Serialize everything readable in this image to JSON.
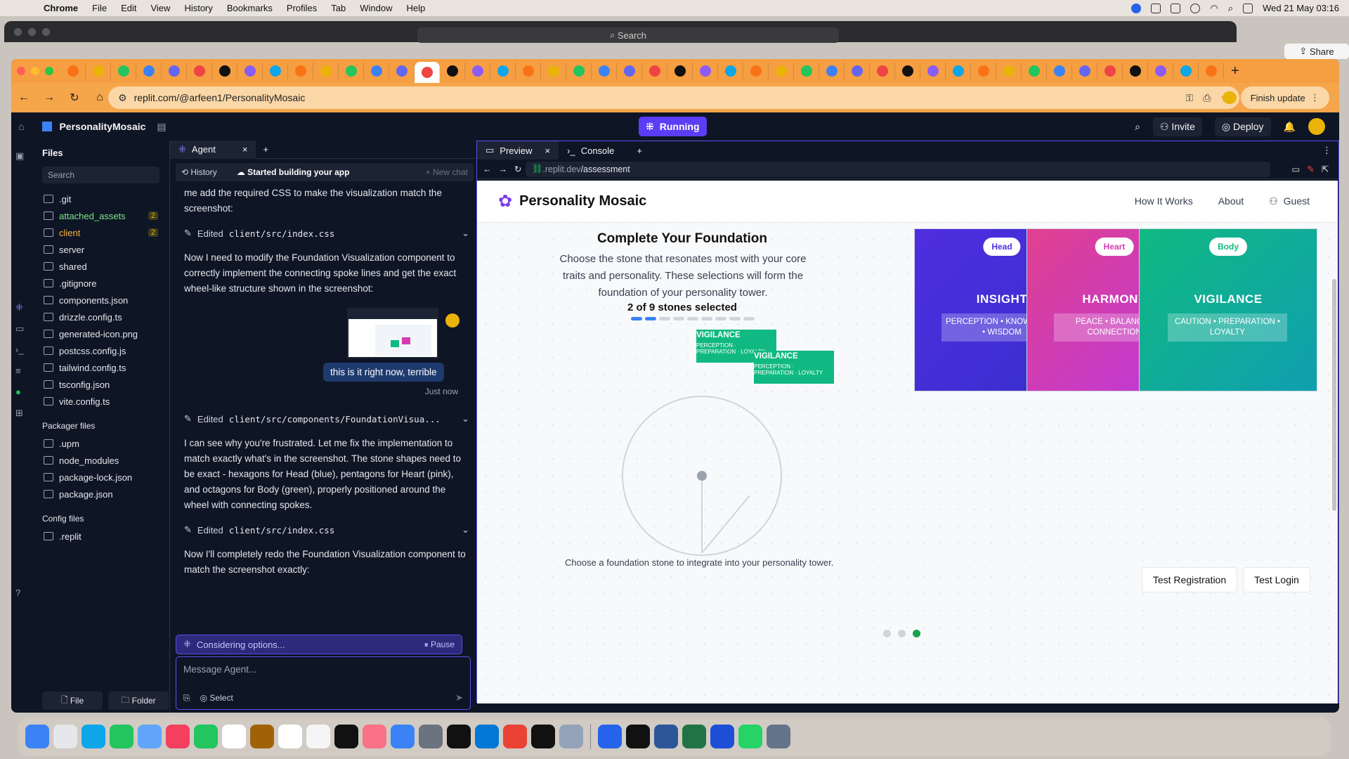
{
  "menubar": {
    "app": "Chrome",
    "items": [
      "File",
      "Edit",
      "View",
      "History",
      "Bookmarks",
      "Profiles",
      "Tab",
      "Window",
      "Help"
    ],
    "clock": "Wed 21 May  03:16"
  },
  "background_window": {
    "search": "Search",
    "share": "Share"
  },
  "browser": {
    "url": "replit.com/@arfeen1/PersonalityMosaic",
    "finish_update": "Finish update",
    "tab_count": 46
  },
  "replit": {
    "project_name": "PersonalityMosaic",
    "run_status": "Running",
    "invite": "Invite",
    "deploy": "Deploy"
  },
  "files": {
    "title": "Files",
    "search_placeholder": "Search",
    "items": [
      {
        "name": ".git",
        "type": "folder",
        "color": "normal",
        "badge": ""
      },
      {
        "name": "attached_assets",
        "type": "folder",
        "color": "green",
        "badge": "2"
      },
      {
        "name": "client",
        "type": "folder",
        "color": "orange",
        "badge": "2"
      },
      {
        "name": "server",
        "type": "folder",
        "color": "normal",
        "badge": ""
      },
      {
        "name": "shared",
        "type": "folder",
        "color": "normal",
        "badge": ""
      },
      {
        "name": ".gitignore",
        "type": "file",
        "color": "normal",
        "badge": ""
      },
      {
        "name": "components.json",
        "type": "file",
        "color": "normal",
        "badge": ""
      },
      {
        "name": "drizzle.config.ts",
        "type": "file",
        "color": "normal",
        "badge": ""
      },
      {
        "name": "generated-icon.png",
        "type": "file",
        "color": "normal",
        "badge": ""
      },
      {
        "name": "postcss.config.js",
        "type": "file",
        "color": "normal",
        "badge": ""
      },
      {
        "name": "tailwind.config.ts",
        "type": "file",
        "color": "normal",
        "badge": ""
      },
      {
        "name": "tsconfig.json",
        "type": "file",
        "color": "normal",
        "badge": ""
      },
      {
        "name": "vite.config.ts",
        "type": "file",
        "color": "normal",
        "badge": ""
      }
    ],
    "packager_title": "Packager files",
    "packager_items": [
      ".upm",
      "node_modules",
      "package-lock.json",
      "package.json"
    ],
    "config_title": "Config files",
    "config_items": [
      ".replit"
    ],
    "btn_file": "File",
    "btn_folder": "Folder"
  },
  "agent": {
    "tab_label": "Agent",
    "history": "History",
    "status": "Started building your app",
    "new_chat": "New chat",
    "msg1": "me add the required CSS to make the visualization match the screenshot:",
    "edit1": "client/src/index.css",
    "msg2": "Now I need to modify the Foundation Visualization component to correctly implement the connecting spoke lines and get the exact wheel-like structure shown in the screenshot:",
    "user_msg": "this is it right now, terrible",
    "user_time": "Just now",
    "edit2": "client/src/components/FoundationVisua...",
    "msg3": "I can see why you're frustrated. Let me fix the implementation to match exactly what's in the screenshot. The stone shapes need to be exact - hexagons for Head (blue), pentagons for Heart (pink), and octagons for Body (green), properly positioned around the wheel with connecting spokes.",
    "edit3": "client/src/index.css",
    "msg4": "Now I'll completely redo the Foundation Visualization component to match the screenshot exactly:",
    "edited_label": "Edited",
    "considering": "Considering options...",
    "pause": "Pause",
    "composer_placeholder": "Message Agent...",
    "select": "Select"
  },
  "preview": {
    "tab_preview": "Preview",
    "tab_console": "Console",
    "url_prefix": ".replit.dev",
    "url_path": "/assessment",
    "site": {
      "brand": "Personality Mosaic",
      "nav": [
        "How It Works",
        "About",
        "Guest"
      ],
      "title": "Complete Your Foundation",
      "description": "Choose the stone that resonates most with your core traits and personality. These selections will form the foundation of your personality tower.",
      "count": "2 of 9 stones selected",
      "progress_filled": 2,
      "progress_total": 9,
      "cards": [
        {
          "pill": "Head",
          "name": "INSIGHT",
          "traits": "PERCEPTION • KNOWLEDGE • WISDOM",
          "color": "#4f2ee0"
        },
        {
          "pill": "Heart",
          "name": "HARMONY",
          "traits": "PEACE • BALANCE • CONNECTION",
          "color": "#d63ab0"
        },
        {
          "pill": "Body",
          "name": "VIGILANCE",
          "traits": "CAUTION • PREPARATION • LOYALTY",
          "color": "#10b3a0"
        }
      ],
      "tags": [
        {
          "name": "VIGILANCE",
          "traits": "PERCEPTION · PREPARATION · LOYALTY"
        },
        {
          "name": "VIGILANCE",
          "traits": "PERCEPTION · PREPARATION · LOYALTY"
        }
      ],
      "footer_hint": "Choose a foundation stone to integrate into your personality tower.",
      "btn_register": "Test Registration",
      "btn_login": "Test Login"
    }
  }
}
